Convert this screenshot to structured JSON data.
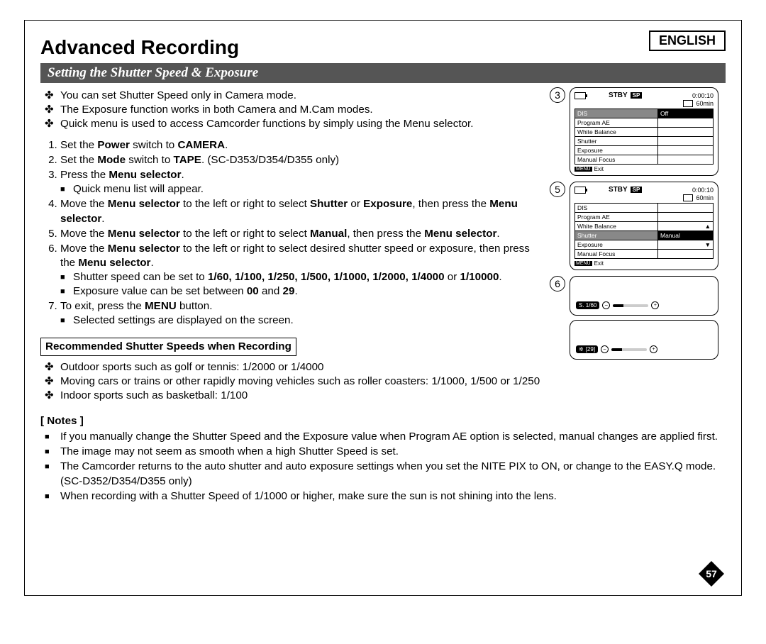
{
  "lang": "ENGLISH",
  "title": "Advanced Recording",
  "subtitle": "Setting the Shutter Speed & Exposure",
  "intro": [
    "You can set Shutter Speed only in Camera mode.",
    "The Exposure function works in both Camera and M.Cam modes.",
    "Quick menu is used to access Camcorder functions by simply using the Menu selector."
  ],
  "steps": {
    "s1_pre": "Set the ",
    "s1_b1": "Power",
    "s1_mid": " switch to ",
    "s1_b2": "CAMERA",
    "s1_post": ".",
    "s2_pre": "Set the ",
    "s2_b1": "Mode",
    "s2_mid": " switch to ",
    "s2_b2": "TAPE",
    "s2_post": ". (SC-D353/D354/D355 only)",
    "s3_pre": "Press the ",
    "s3_b": "Menu selector",
    "s3_post": ".",
    "s3_sub": "Quick menu list will appear.",
    "s4_pre": "Move the ",
    "s4_b1": "Menu selector",
    "s4_mid1": " to the left or right to select ",
    "s4_b2": "Shutter",
    "s4_or": " or ",
    "s4_b3": "Exposure",
    "s4_mid2": ", then press the ",
    "s4_b4": "Menu selector",
    "s4_post": ".",
    "s5_pre": "Move the ",
    "s5_b1": "Menu selector",
    "s5_mid1": " to the left or right to select ",
    "s5_b2": "Manual",
    "s5_mid2": ", then press the ",
    "s5_b3": "Menu selector",
    "s5_post": ".",
    "s6_pre": "Move the ",
    "s6_b1": "Menu selector",
    "s6_mid1": " to the left or right to select desired shutter speed or exposure, then press the ",
    "s6_b2": "Menu selector",
    "s6_post": ".",
    "s6_sub1_pre": "Shutter speed can be set to ",
    "s6_sub1_vals": "1/60, 1/100, 1/250, 1/500, 1/1000, 1/2000, 1/4000",
    "s6_sub1_or": " or ",
    "s6_sub1_last": "1/10000",
    "s6_sub1_post": ".",
    "s6_sub2_pre": "Exposure value can be set between ",
    "s6_sub2_v1": "00",
    "s6_sub2_and": " and ",
    "s6_sub2_v2": "29",
    "s6_sub2_post": ".",
    "s7_pre": "To exit, press the ",
    "s7_b": "MENU",
    "s7_post": " button.",
    "s7_sub": "Selected settings are displayed on the screen."
  },
  "rec_heading": "Recommended Shutter Speeds when Recording",
  "rec": [
    "Outdoor sports such as golf or tennis: 1/2000 or 1/4000",
    "Moving cars or trains or other rapidly moving vehicles such as roller coasters: 1/1000, 1/500 or 1/250",
    "Indoor sports such as basketball: 1/100"
  ],
  "notes_label": "[ Notes ]",
  "notes": [
    "If you manually change the Shutter Speed and the Exposure value when Program AE option is selected, manual changes are applied first.",
    "The image may not seem as smooth when a high Shutter Speed is set.",
    "The Camcorder returns to the auto shutter and auto exposure settings when you set the NITE PIX to ON, or change to the EASY.Q mode. (SC-D352/D354/D355 only)",
    "When recording with a Shutter Speed of 1/1000 or higher, make sure the sun is not shining into the lens."
  ],
  "screens": {
    "status": {
      "stby": "STBY",
      "sp": "SP",
      "time": "0:00:10",
      "tape": "60min"
    },
    "menu3": [
      {
        "label": "DIS",
        "val": "Off",
        "sel": true,
        "sel2": true
      },
      {
        "label": "Program AE",
        "val": ""
      },
      {
        "label": "White Balance",
        "val": ""
      },
      {
        "label": "Shutter",
        "val": ""
      },
      {
        "label": "Exposure",
        "val": ""
      },
      {
        "label": "Manual Focus",
        "val": ""
      }
    ],
    "menu5": [
      {
        "label": "DIS",
        "val": ""
      },
      {
        "label": "Program AE",
        "val": ""
      },
      {
        "label": "White Balance",
        "val": ""
      },
      {
        "label": "Shutter",
        "val": "Manual",
        "sel": true
      },
      {
        "label": "Exposure",
        "val": ""
      },
      {
        "label": "Manual Focus",
        "val": ""
      }
    ],
    "exit_label": "Exit",
    "menu_tag": "MENU",
    "num3": "3",
    "num5": "5",
    "num6": "6",
    "shutter_disp": "S. 1/60",
    "exposure_disp": "[29]"
  },
  "page_number": "57"
}
